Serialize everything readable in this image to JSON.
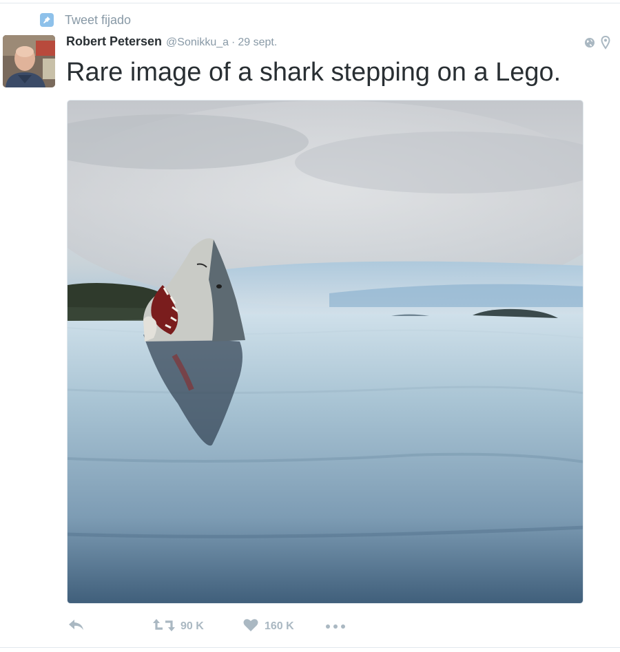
{
  "pinned": {
    "label": "Tweet fijado",
    "icon": "pin-icon"
  },
  "tweet": {
    "author_name": "Robert Petersen",
    "handle": "@Sonikku_a",
    "separator": "·",
    "date": "29 sept.",
    "text": "Rare image of a shark stepping on a Lego.",
    "media_icon_names": [
      "globe-icon",
      "location-pin-icon"
    ]
  },
  "actions": {
    "reply": {
      "icon": "reply-icon"
    },
    "retweet": {
      "icon": "retweet-icon",
      "count": "90 K"
    },
    "like": {
      "icon": "heart-icon",
      "count": "160 K"
    },
    "more": {
      "icon": "more-dots-icon"
    }
  },
  "colors": {
    "text": "#292f33",
    "muted": "#8899a6",
    "action_gray": "#aab8c2",
    "pin_badge": "#8ec1ea",
    "divider": "#e1e8ed"
  }
}
